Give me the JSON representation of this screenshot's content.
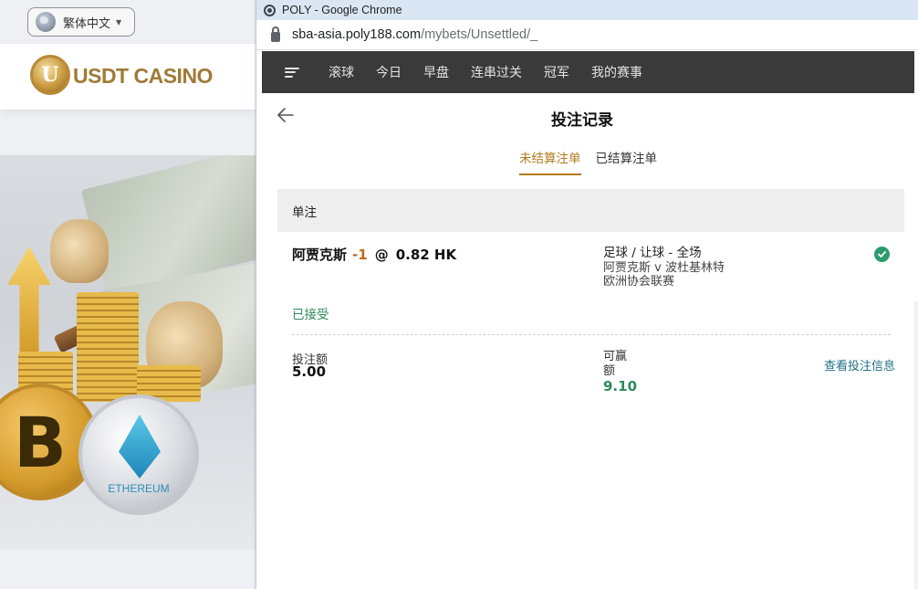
{
  "background_site": {
    "language_selector": {
      "label": "繁体中文"
    },
    "logo_text": "USDT CASINO",
    "logo_coin_letter": "U",
    "promo_ethereum_label": "ETHEREUM",
    "promo_btc_symbol": "B"
  },
  "window": {
    "title": "POLY - Google Chrome",
    "url_host": "sba-asia.poly188.com",
    "url_path": "/mybets/Unsettled/_"
  },
  "app_nav": {
    "items": [
      "滚球",
      "今日",
      "早盘",
      "连串过关",
      "冠军",
      "我的赛事"
    ]
  },
  "page": {
    "title": "投注记录",
    "tabs": [
      {
        "label": "未结算注单",
        "active": true
      },
      {
        "label": "已结算注单",
        "active": false
      }
    ]
  },
  "bet": {
    "section_label": "单注",
    "selection": "阿贾克斯",
    "handicap": "-1",
    "at": "@",
    "odds": "0.82 HK",
    "market": "足球 / 让球 - 全场",
    "match": "阿贾克斯 v 波杜基林特",
    "league": "欧洲协会联赛",
    "status": "已接受",
    "stake_label": "投注额",
    "stake_value": "5.00",
    "win_label": "可赢额",
    "win_value": "9.10",
    "view_details": "查看投注信息"
  },
  "colors": {
    "accent_tab": "#b27a1e",
    "handicap": "#b8691e",
    "success": "#2e8b5e",
    "nav_bg": "#3a3a3a",
    "link": "#1f6f86"
  }
}
